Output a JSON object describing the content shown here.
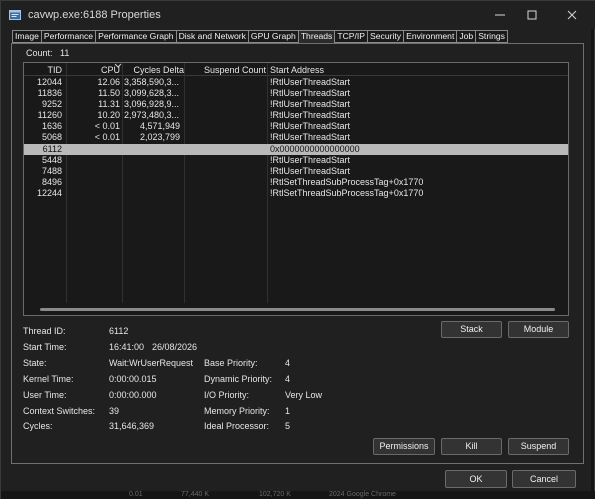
{
  "window": {
    "title": "cavwp.exe:6188 Properties"
  },
  "tabs": [
    {
      "label": "Image"
    },
    {
      "label": "Performance"
    },
    {
      "label": "Performance Graph"
    },
    {
      "label": "Disk and Network"
    },
    {
      "label": "GPU Graph"
    },
    {
      "label": "Threads"
    },
    {
      "label": "TCP/IP"
    },
    {
      "label": "Security"
    },
    {
      "label": "Environment"
    },
    {
      "label": "Job"
    },
    {
      "label": "Strings"
    }
  ],
  "active_tab": "Threads",
  "count": {
    "label": "Count:",
    "value": "11"
  },
  "table": {
    "columns": [
      "TID",
      "CPU",
      "Cycles Delta",
      "Suspend Count",
      "Start Address"
    ],
    "rows": [
      {
        "tid": "12044",
        "cpu": "12.06",
        "cycles": "3,358,590,3...",
        "suspend": "",
        "start": "!RtlUserThreadStart"
      },
      {
        "tid": "11836",
        "cpu": "11.50",
        "cycles": "3,099,628,3...",
        "suspend": "",
        "start": "!RtlUserThreadStart"
      },
      {
        "tid": "9252",
        "cpu": "11.31",
        "cycles": "3,096,928,9...",
        "suspend": "",
        "start": "!RtlUserThreadStart"
      },
      {
        "tid": "11260",
        "cpu": "10.20",
        "cycles": "2,973,480,3...",
        "suspend": "",
        "start": "!RtlUserThreadStart"
      },
      {
        "tid": "1636",
        "cpu": "< 0.01",
        "cycles": "4,571,949",
        "suspend": "",
        "start": "!RtlUserThreadStart"
      },
      {
        "tid": "5068",
        "cpu": "< 0.01",
        "cycles": "2,023,799",
        "suspend": "",
        "start": "!RtlUserThreadStart"
      },
      {
        "tid": "6112",
        "cpu": "",
        "cycles": "",
        "suspend": "",
        "start": "0x0000000000000000"
      },
      {
        "tid": "5448",
        "cpu": "",
        "cycles": "",
        "suspend": "",
        "start": "!RtlUserThreadStart"
      },
      {
        "tid": "7488",
        "cpu": "",
        "cycles": "",
        "suspend": "",
        "start": "!RtlUserThreadStart"
      },
      {
        "tid": "8496",
        "cpu": "",
        "cycles": "",
        "suspend": "",
        "start": "!RtlSetThreadSubProcessTag+0x1770"
      },
      {
        "tid": "12244",
        "cpu": "",
        "cycles": "",
        "suspend": "",
        "start": "!RtlSetThreadSubProcessTag+0x1770"
      }
    ],
    "selected_tid": "6112"
  },
  "details": {
    "thread_id_label": "Thread ID:",
    "thread_id": "6112",
    "start_time_label": "Start Time:",
    "start_time": "16:41:00",
    "start_date": "26/08/2026",
    "state_label": "State:",
    "state": "Wait:WrUserRequest",
    "kernel_time_label": "Kernel Time:",
    "kernel_time": "0:00:00.015",
    "user_time_label": "User Time:",
    "user_time": "0:00:00.000",
    "context_switches_label": "Context Switches:",
    "context_switches": "39",
    "cycles_label": "Cycles:",
    "cycles": "31,646,369",
    "base_priority_label": "Base Priority:",
    "base_priority": "4",
    "dynamic_priority_label": "Dynamic Priority:",
    "dynamic_priority": "4",
    "io_priority_label": "I/O Priority:",
    "io_priority": "Very Low",
    "memory_priority_label": "Memory Priority:",
    "memory_priority": "1",
    "ideal_processor_label": "Ideal Processor:",
    "ideal_processor": "5"
  },
  "buttons": {
    "stack": "Stack",
    "module": "Module",
    "permissions": "Permissions",
    "kill": "Kill",
    "suspend": "Suspend",
    "ok": "OK",
    "cancel": "Cancel"
  },
  "background": {
    "a": "0.01",
    "b": "77,440 K",
    "c": "102,720 K",
    "d": "2024 Google Chrome"
  },
  "colors": {
    "window_bg": "#202020",
    "table_bg": "#191919",
    "selected_row": "#b9b9b9",
    "border": "#707070"
  }
}
